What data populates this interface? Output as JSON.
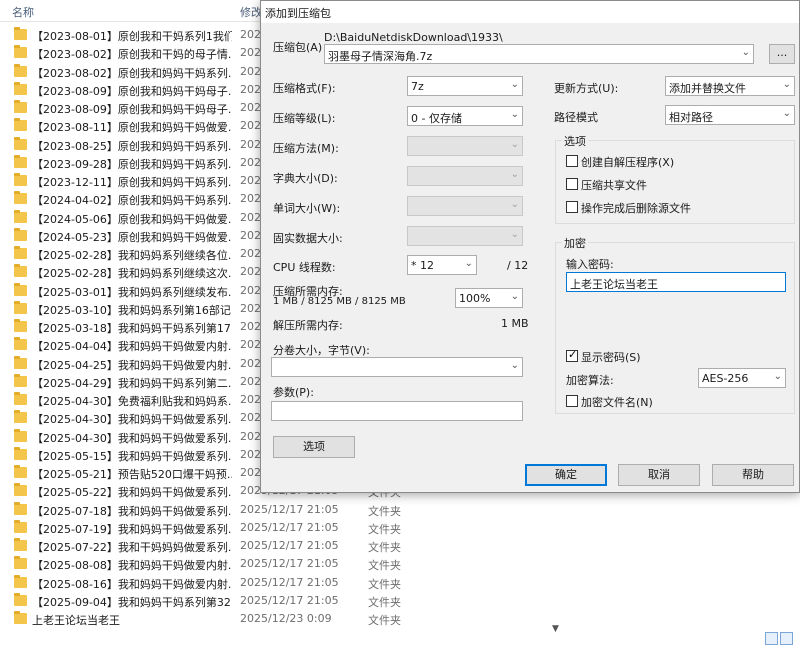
{
  "explorer": {
    "col_name": "名称",
    "col_modified": "修改",
    "rows": [
      {
        "name": "【2023-08-01】原创我和干妈系列1我们...",
        "date": "202",
        "type": ""
      },
      {
        "name": "【2023-08-02】原创我和干妈的母子情...",
        "date": "202",
        "type": ""
      },
      {
        "name": "【2023-08-02】原创我和妈妈干妈系列...",
        "date": "202",
        "type": ""
      },
      {
        "name": "【2023-08-09】原创我和妈妈干妈母子...",
        "date": "202",
        "type": ""
      },
      {
        "name": "【2023-08-09】原创我和妈妈干妈母子...",
        "date": "202",
        "type": ""
      },
      {
        "name": "【2023-08-11】原创我和妈妈干妈做爱...",
        "date": "202",
        "type": ""
      },
      {
        "name": "【2023-08-25】原创我和妈妈干妈系列...",
        "date": "202",
        "type": ""
      },
      {
        "name": "【2023-09-28】原创我和妈妈干妈系列...",
        "date": "202",
        "type": ""
      },
      {
        "name": "【2023-12-11】原创我和妈妈干妈系列...",
        "date": "202",
        "type": ""
      },
      {
        "name": "【2024-04-02】原创我和妈妈干妈系列...",
        "date": "202",
        "type": ""
      },
      {
        "name": "【2024-05-06】原创我和妈妈干妈做爱...",
        "date": "202",
        "type": ""
      },
      {
        "name": "【2024-05-23】原创我和妈妈干妈做爱...",
        "date": "202",
        "type": ""
      },
      {
        "name": "【2025-02-28】我和妈妈系列继续各位...",
        "date": "202",
        "type": ""
      },
      {
        "name": "【2025-02-28】我和妈妈系列继续这次...",
        "date": "202",
        "type": ""
      },
      {
        "name": "【2025-03-01】我和妈妈系列继续发布...",
        "date": "202",
        "type": ""
      },
      {
        "name": "【2025-03-10】我和妈妈系列第16部记...",
        "date": "202",
        "type": ""
      },
      {
        "name": "【2025-03-18】我和妈妈干妈系列第17...",
        "date": "202",
        "type": ""
      },
      {
        "name": "【2025-04-04】我和妈妈干妈做爱内射...",
        "date": "202",
        "type": ""
      },
      {
        "name": "【2025-04-25】我和妈妈干妈做爱内射...",
        "date": "202",
        "type": ""
      },
      {
        "name": "【2025-04-29】我和妈妈干妈系列第二...",
        "date": "202",
        "type": ""
      },
      {
        "name": "【2025-04-30】免费福利贴我和妈妈系...",
        "date": "202",
        "type": ""
      },
      {
        "name": "【2025-04-30】我和妈妈干妈做爱系列...",
        "date": "202",
        "type": ""
      },
      {
        "name": "【2025-04-30】我和妈妈干妈做爱系列...",
        "date": "202",
        "type": ""
      },
      {
        "name": "【2025-05-15】我和妈妈干妈做爱系列...",
        "date": "202",
        "type": ""
      },
      {
        "name": "【2025-05-21】预告贴520口爆干妈预...",
        "date": "202",
        "type": ""
      },
      {
        "name": "【2025-05-22】我和妈妈干妈做爱系列...",
        "date": "2025/12/17 21:05",
        "type": "文件夹"
      },
      {
        "name": "【2025-07-18】我和妈妈干妈做爱系列...",
        "date": "2025/12/17 21:05",
        "type": "文件夹"
      },
      {
        "name": "【2025-07-19】我和妈妈干妈做爱系列...",
        "date": "2025/12/17 21:05",
        "type": "文件夹"
      },
      {
        "name": "【2025-07-22】我和干妈妈妈做爱系列...",
        "date": "2025/12/17 21:05",
        "type": "文件夹"
      },
      {
        "name": "【2025-08-08】我和妈妈干妈做爱内射...",
        "date": "2025/12/17 21:05",
        "type": "文件夹"
      },
      {
        "name": "【2025-08-16】我和妈妈干妈做爱内射...",
        "date": "2025/12/17 21:05",
        "type": "文件夹"
      },
      {
        "name": "【2025-09-04】我和妈妈干妈系列第32...",
        "date": "2025/12/17 21:05",
        "type": "文件夹"
      },
      {
        "name": "上老王论坛当老王",
        "date": "2025/12/23 0:09",
        "type": "文件夹"
      }
    ]
  },
  "dialog": {
    "title": "添加到压缩包",
    "archive_label": "压缩包(A)",
    "archive_path": "D:\\BaiduNetdiskDownload\\1933\\",
    "archive_name": "羽墨母子情深海角.7z",
    "browse_label": "...",
    "format_label": "压缩格式(F):",
    "format_value": "7z",
    "level_label": "压缩等级(L):",
    "level_value": "0 - 仅存储",
    "method_label": "压缩方法(M):",
    "dict_label": "字典大小(D):",
    "word_label": "单词大小(W):",
    "solid_label": "固实数据大小:",
    "cpu_label": "CPU 线程数:",
    "cpu_value": "* 12",
    "cpu_total": "/ 12",
    "mem_label": "压缩所需内存:",
    "mem_detail": "1 MB / 8125 MB / 8125 MB",
    "mem_percent": "100%",
    "decomp_label": "解压所需内存:",
    "decomp_value": "1 MB",
    "split_label": "分卷大小，字节(V):",
    "split_value": "",
    "params_label": "参数(P):",
    "params_value": "",
    "options_button": "选项",
    "update_label": "更新方式(U):",
    "update_value": "添加并替换文件",
    "path_label": "路径模式",
    "path_value": "相对路径",
    "options_group": "选项",
    "opt_sfx": "创建自解压程序(X)",
    "opt_shared": "压缩共享文件",
    "opt_delete": "操作完成后删除源文件",
    "encrypt_group": "加密",
    "password_label": "输入密码:",
    "password_value": "上老王论坛当老王",
    "show_password": "显示密码(S)",
    "enc_method_label": "加密算法:",
    "enc_method_value": "AES-256",
    "encrypt_names": "加密文件名(N)",
    "ok": "确定",
    "cancel": "取消",
    "help": "帮助"
  }
}
